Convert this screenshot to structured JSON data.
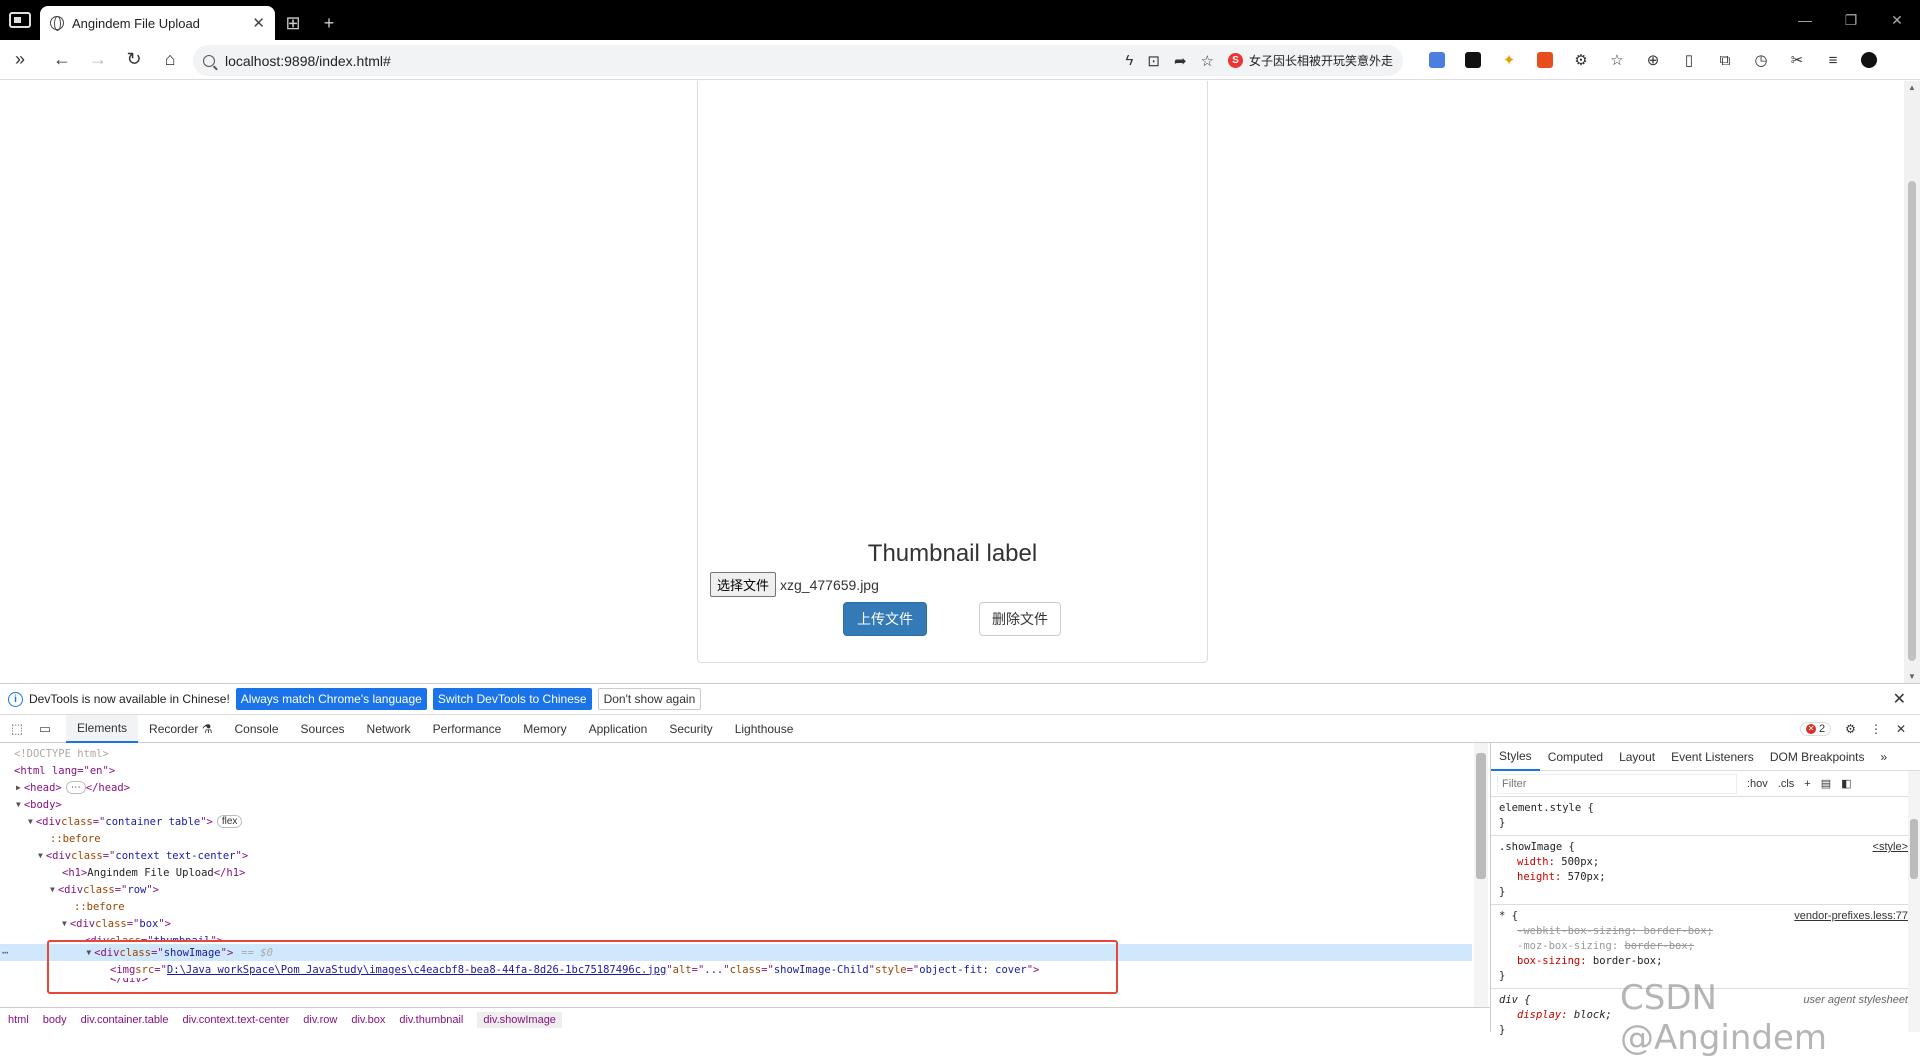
{
  "browser": {
    "tab_title": "Angindem File Upload",
    "url": "localhost:9898/index.html#",
    "hot_search": "女子因长相被开玩笑意外走",
    "icons": [
      "sidebar-toggle-icon",
      "back-icon",
      "forward-icon",
      "reload-icon",
      "home-icon"
    ]
  },
  "page": {
    "thumbnail_label": "Thumbnail label",
    "choose_file_label": "选择文件",
    "file_name": "xzg_477659.jpg",
    "upload_label": "上传文件",
    "delete_label": "删除文件"
  },
  "devtools": {
    "info_text": "DevTools is now available in Chinese!",
    "match_lang_label": "Always match Chrome's language",
    "switch_label": "Switch DevTools to Chinese",
    "dont_show_label": "Don't show again",
    "tabs": [
      "Elements",
      "Recorder ⚗",
      "Console",
      "Sources",
      "Network",
      "Performance",
      "Memory",
      "Application",
      "Security",
      "Lighthouse"
    ],
    "error_count": "2",
    "dom": {
      "doctype": "<!DOCTYPE html>",
      "html_open": "<html lang=\"en\">",
      "head": "<head>",
      "head_close": "</head>",
      "body": "<body>",
      "container_class": "container table",
      "flex_badge": "flex",
      "before": "::before",
      "context_class": "context text-center",
      "h1_text": "Angindem File Upload",
      "row_class": "row",
      "box_class": "box",
      "thumbnail_class": "thumbnail",
      "showimage_class": "showImage",
      "selected_marker": "== $0",
      "img_src": "D:\\Java workSpace\\Pom JavaStudy\\images\\c4eacbf8-bea8-44fa-8d26-1bc75187496c.jpg",
      "img_alt": "...",
      "img_class": "showImage-Child",
      "img_style": "object-fit: cover"
    },
    "breadcrumbs": [
      "html",
      "body",
      "div.container.table",
      "div.context.text-center",
      "div.row",
      "div.box",
      "div.thumbnail",
      "div.showImage"
    ],
    "styles_tabs": [
      "Styles",
      "Computed",
      "Layout",
      "Event Listeners",
      "DOM Breakpoints"
    ],
    "filter_placeholder": "Filter",
    "hov": ":hov",
    "cls": ".cls",
    "rules": {
      "element_style": "element.style {",
      "showimage_selector": ".showImage {",
      "showimage_src": "<style>",
      "width_prop": "width",
      "width_val": "500px;",
      "height_prop": "height",
      "height_val": "570px;",
      "star_selector": "* {",
      "star_src": "vendor-prefixes.less:77",
      "webkit_prop": "-webkit-box-sizing",
      "webkit_val": "border-box;",
      "moz_prop": "-moz-box-sizing",
      "moz_val": "border-box;",
      "bs_prop": "box-sizing",
      "bs_val": "border-box;",
      "div_selector": "div {",
      "div_src": "user agent stylesheet",
      "display_prop": "display",
      "display_val": "block;"
    }
  },
  "watermark": "CSDN @Angindem"
}
